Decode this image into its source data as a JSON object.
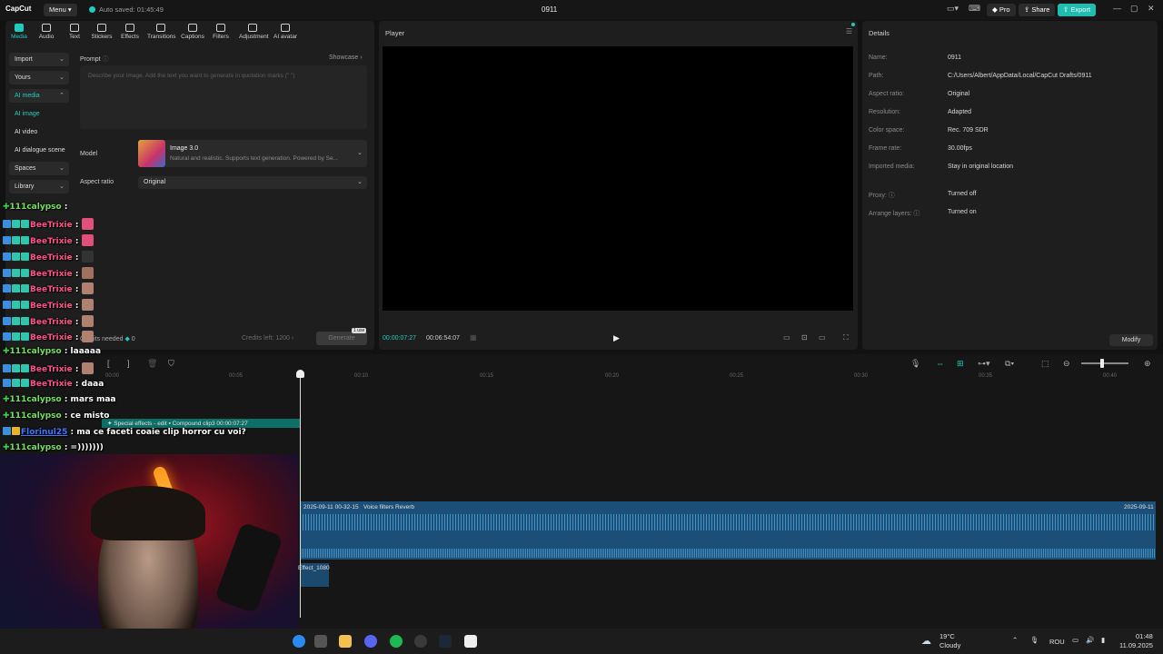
{
  "titlebar": {
    "app_name": "CapCut",
    "menu_label": "Menu",
    "autosave": "Auto saved: 01:45:49",
    "project_title": "0911",
    "pro_label": "Pro",
    "share_label": "Share",
    "export_label": "Export"
  },
  "toolbar": [
    "Media",
    "Audio",
    "Text",
    "Stickers",
    "Effects",
    "Transitions",
    "Captions",
    "Filters",
    "Adjustment",
    "AI avatar"
  ],
  "sidebar": {
    "import": "Import",
    "yours": "Yours",
    "ai_media": "AI media",
    "ai_image": "AI image",
    "ai_video": "AI video",
    "ai_dialogue": "AI dialogue scene",
    "spaces": "Spaces",
    "library": "Library"
  },
  "ai_image": {
    "prompt_label": "Prompt",
    "showcase": "Showcase",
    "placeholder": "Describe your image. Add the text you want to generate in quotation marks (\" \")",
    "model_label": "Model",
    "model_name": "Image 3.0",
    "model_desc": "Natural and realistic. Supports text generation. Powered by Se...",
    "aspect_label": "Aspect ratio",
    "aspect_value": "Original",
    "credits_needed": "Credits needed",
    "credits_value": "0",
    "credits_left": "Credits left: 1200",
    "generate": "Generate",
    "use_badge": "1 use"
  },
  "player": {
    "title": "Player",
    "time_current": "00:00:07:27",
    "time_total": "00:06:54:07"
  },
  "details": {
    "title": "Details",
    "rows": [
      {
        "key": "Name:",
        "val": "0911"
      },
      {
        "key": "Path:",
        "val": "C:/Users/Albert/AppData/Local/CapCut Drafts/0911"
      },
      {
        "key": "Aspect ratio:",
        "val": "Original"
      },
      {
        "key": "Resolution:",
        "val": "Adapted"
      },
      {
        "key": "Color space:",
        "val": "Rec. 709 SDR"
      },
      {
        "key": "Frame rate:",
        "val": "30.00fps"
      },
      {
        "key": "Imported media:",
        "val": "Stay in original location"
      },
      {
        "key": "Proxy:",
        "val": "Turned off"
      },
      {
        "key": "Arrange layers:",
        "val": "Turned on"
      }
    ],
    "modify": "Modify"
  },
  "timeline": {
    "ticks": [
      "00:00",
      "00:05",
      "00:10",
      "00:15",
      "00:20",
      "00:25",
      "00:30",
      "00:35",
      "00:40"
    ],
    "clip_effects": "Special effects - edit",
    "clip_compound": "Compound clip3",
    "clip_compound_time": "00:00:07:27",
    "audio_date": "2025-09-11 00-32-15",
    "audio_filter": "Voice filters Reverb",
    "audio_date_end": "2025-09-11",
    "fx_clip": "Effect_1080"
  },
  "chat": [
    {
      "user": "111calypso",
      "msg": ":",
      "color": "green"
    },
    {
      "user": "BeeTrixie",
      "msg": ":",
      "color": "pink"
    },
    {
      "user": "BeeTrixie",
      "msg": ":",
      "color": "pink"
    },
    {
      "user": "BeeTrixie",
      "msg": ":",
      "color": "pink"
    },
    {
      "user": "BeeTrixie",
      "msg": ":",
      "color": "pink"
    },
    {
      "user": "BeeTrixie",
      "msg": ":",
      "color": "pink"
    },
    {
      "user": "BeeTrixie",
      "msg": ":",
      "color": "pink"
    },
    {
      "user": "BeeTrixie",
      "msg": ":",
      "color": "pink"
    },
    {
      "user": "BeeTrixie",
      "msg": ":",
      "color": "pink"
    },
    {
      "user": "111calypso",
      "msg": ": laaaaa",
      "color": "green"
    },
    {
      "user": "BeeTrixie",
      "msg": ":",
      "color": "pink"
    },
    {
      "user": "BeeTrixie",
      "msg": ": daaa",
      "color": "pink"
    },
    {
      "user": "111calypso",
      "msg": ": mars maa",
      "color": "green"
    },
    {
      "user": "111calypso",
      "msg": ": ce misto",
      "color": "green"
    },
    {
      "user": "Florinul25",
      "msg": ": ma ce faceti coaie clip horror cu voi?",
      "color": "blue"
    },
    {
      "user": "111calypso",
      "msg": ": =)))))))",
      "color": "green"
    }
  ],
  "taskbar": {
    "temp": "19°C",
    "weather": "Cloudy",
    "lang": "ROU",
    "time": "01:48",
    "date": "11.09.2025"
  }
}
